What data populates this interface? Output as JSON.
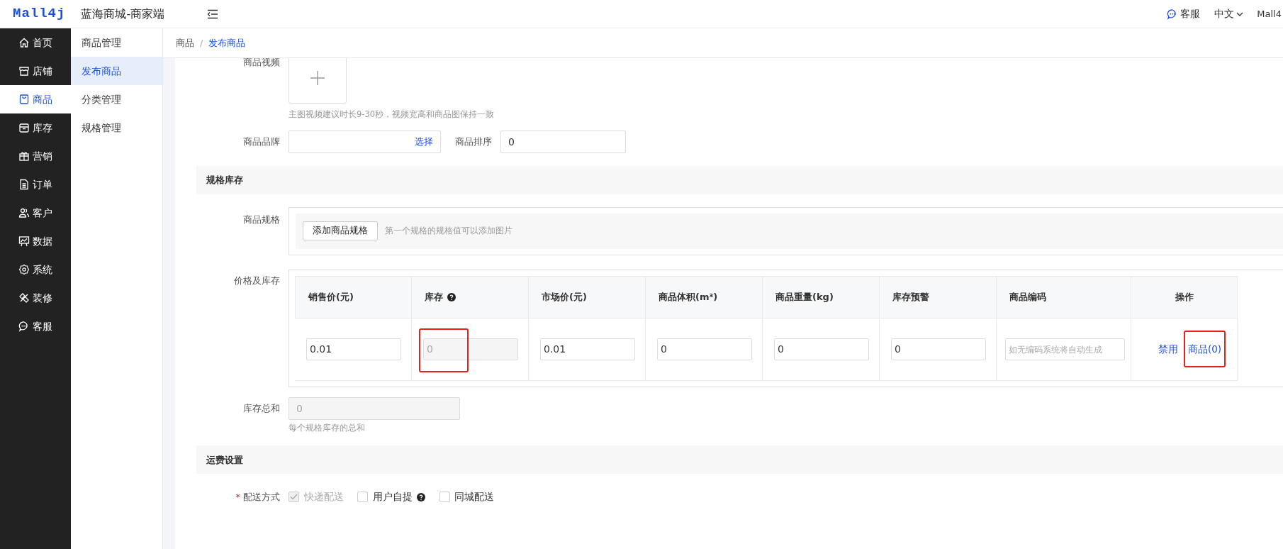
{
  "header": {
    "logo": "Mall4j",
    "title": "蓝海商城-商家端",
    "service": "客服",
    "language": "中文",
    "user": "Mall4"
  },
  "sidebar": {
    "items": [
      {
        "label": "首页",
        "selected": false
      },
      {
        "label": "店铺",
        "selected": false
      },
      {
        "label": "商品",
        "selected": true
      },
      {
        "label": "库存",
        "selected": false
      },
      {
        "label": "营销",
        "selected": false
      },
      {
        "label": "订单",
        "selected": false
      },
      {
        "label": "客户",
        "selected": false
      },
      {
        "label": "数据",
        "selected": false
      },
      {
        "label": "系统",
        "selected": false
      },
      {
        "label": "装修",
        "selected": false
      },
      {
        "label": "客服",
        "selected": false
      }
    ]
  },
  "submenu": {
    "items": [
      {
        "label": "商品管理",
        "selected": false
      },
      {
        "label": "发布商品",
        "selected": true
      },
      {
        "label": "分类管理",
        "selected": false
      },
      {
        "label": "规格管理",
        "selected": false
      }
    ]
  },
  "breadcrumb": [
    "商品",
    "/",
    "发布商品"
  ],
  "video": {
    "label": "商品视频",
    "hint": "主图视频建议时长9-30秒，视频宽高和商品图保持一致"
  },
  "brand": {
    "label": "商品品牌",
    "action": "选择"
  },
  "sort": {
    "label": "商品排序",
    "value": "0"
  },
  "spec_section": {
    "title": "规格库存"
  },
  "spec": {
    "label": "商品规格",
    "button": "添加商品规格",
    "hint": "第一个规格的规格值可以添加图片"
  },
  "price_stock": {
    "label": "价格及库存",
    "columns": [
      {
        "label": "销售价(元)",
        "help": false
      },
      {
        "label": "库存",
        "help": true
      },
      {
        "label": "市场价(元)",
        "help": false
      },
      {
        "label": "商品体积(m³)",
        "help": false
      },
      {
        "label": "商品重量(kg)",
        "help": false
      },
      {
        "label": "库存预警",
        "help": false
      },
      {
        "label": "商品编码",
        "help": false
      },
      {
        "label": "操作",
        "help": false
      }
    ],
    "cells": [
      {
        "value": "0.01",
        "disabled": false,
        "highlighted": false
      },
      {
        "value": "0",
        "disabled": true,
        "highlighted": true
      },
      {
        "value": "0.01",
        "disabled": false,
        "highlighted": false
      },
      {
        "value": "0",
        "disabled": false,
        "highlighted": false
      },
      {
        "value": "0",
        "disabled": false,
        "highlighted": false
      },
      {
        "value": "0",
        "disabled": false,
        "highlighted": false
      },
      {
        "placeholder": "如无编码系统将自动生成",
        "disabled": false,
        "highlighted": false
      }
    ],
    "actions": [
      {
        "label": "禁用",
        "highlighted": false
      },
      {
        "label": "商品(0)",
        "highlighted": true
      }
    ]
  },
  "stock_total": {
    "label": "库存总和",
    "value": "0",
    "hint": "每个规格库存的总和"
  },
  "shipping_section": {
    "title": "运费设置"
  },
  "delivery": {
    "label": "配送方式",
    "required_mark": "*",
    "options": [
      {
        "label": "快递配送",
        "checked": true,
        "disabled": true,
        "help": false
      },
      {
        "label": "用户自提",
        "checked": false,
        "disabled": false,
        "help": true
      },
      {
        "label": "同城配送",
        "checked": false,
        "disabled": false,
        "help": false
      }
    ]
  }
}
